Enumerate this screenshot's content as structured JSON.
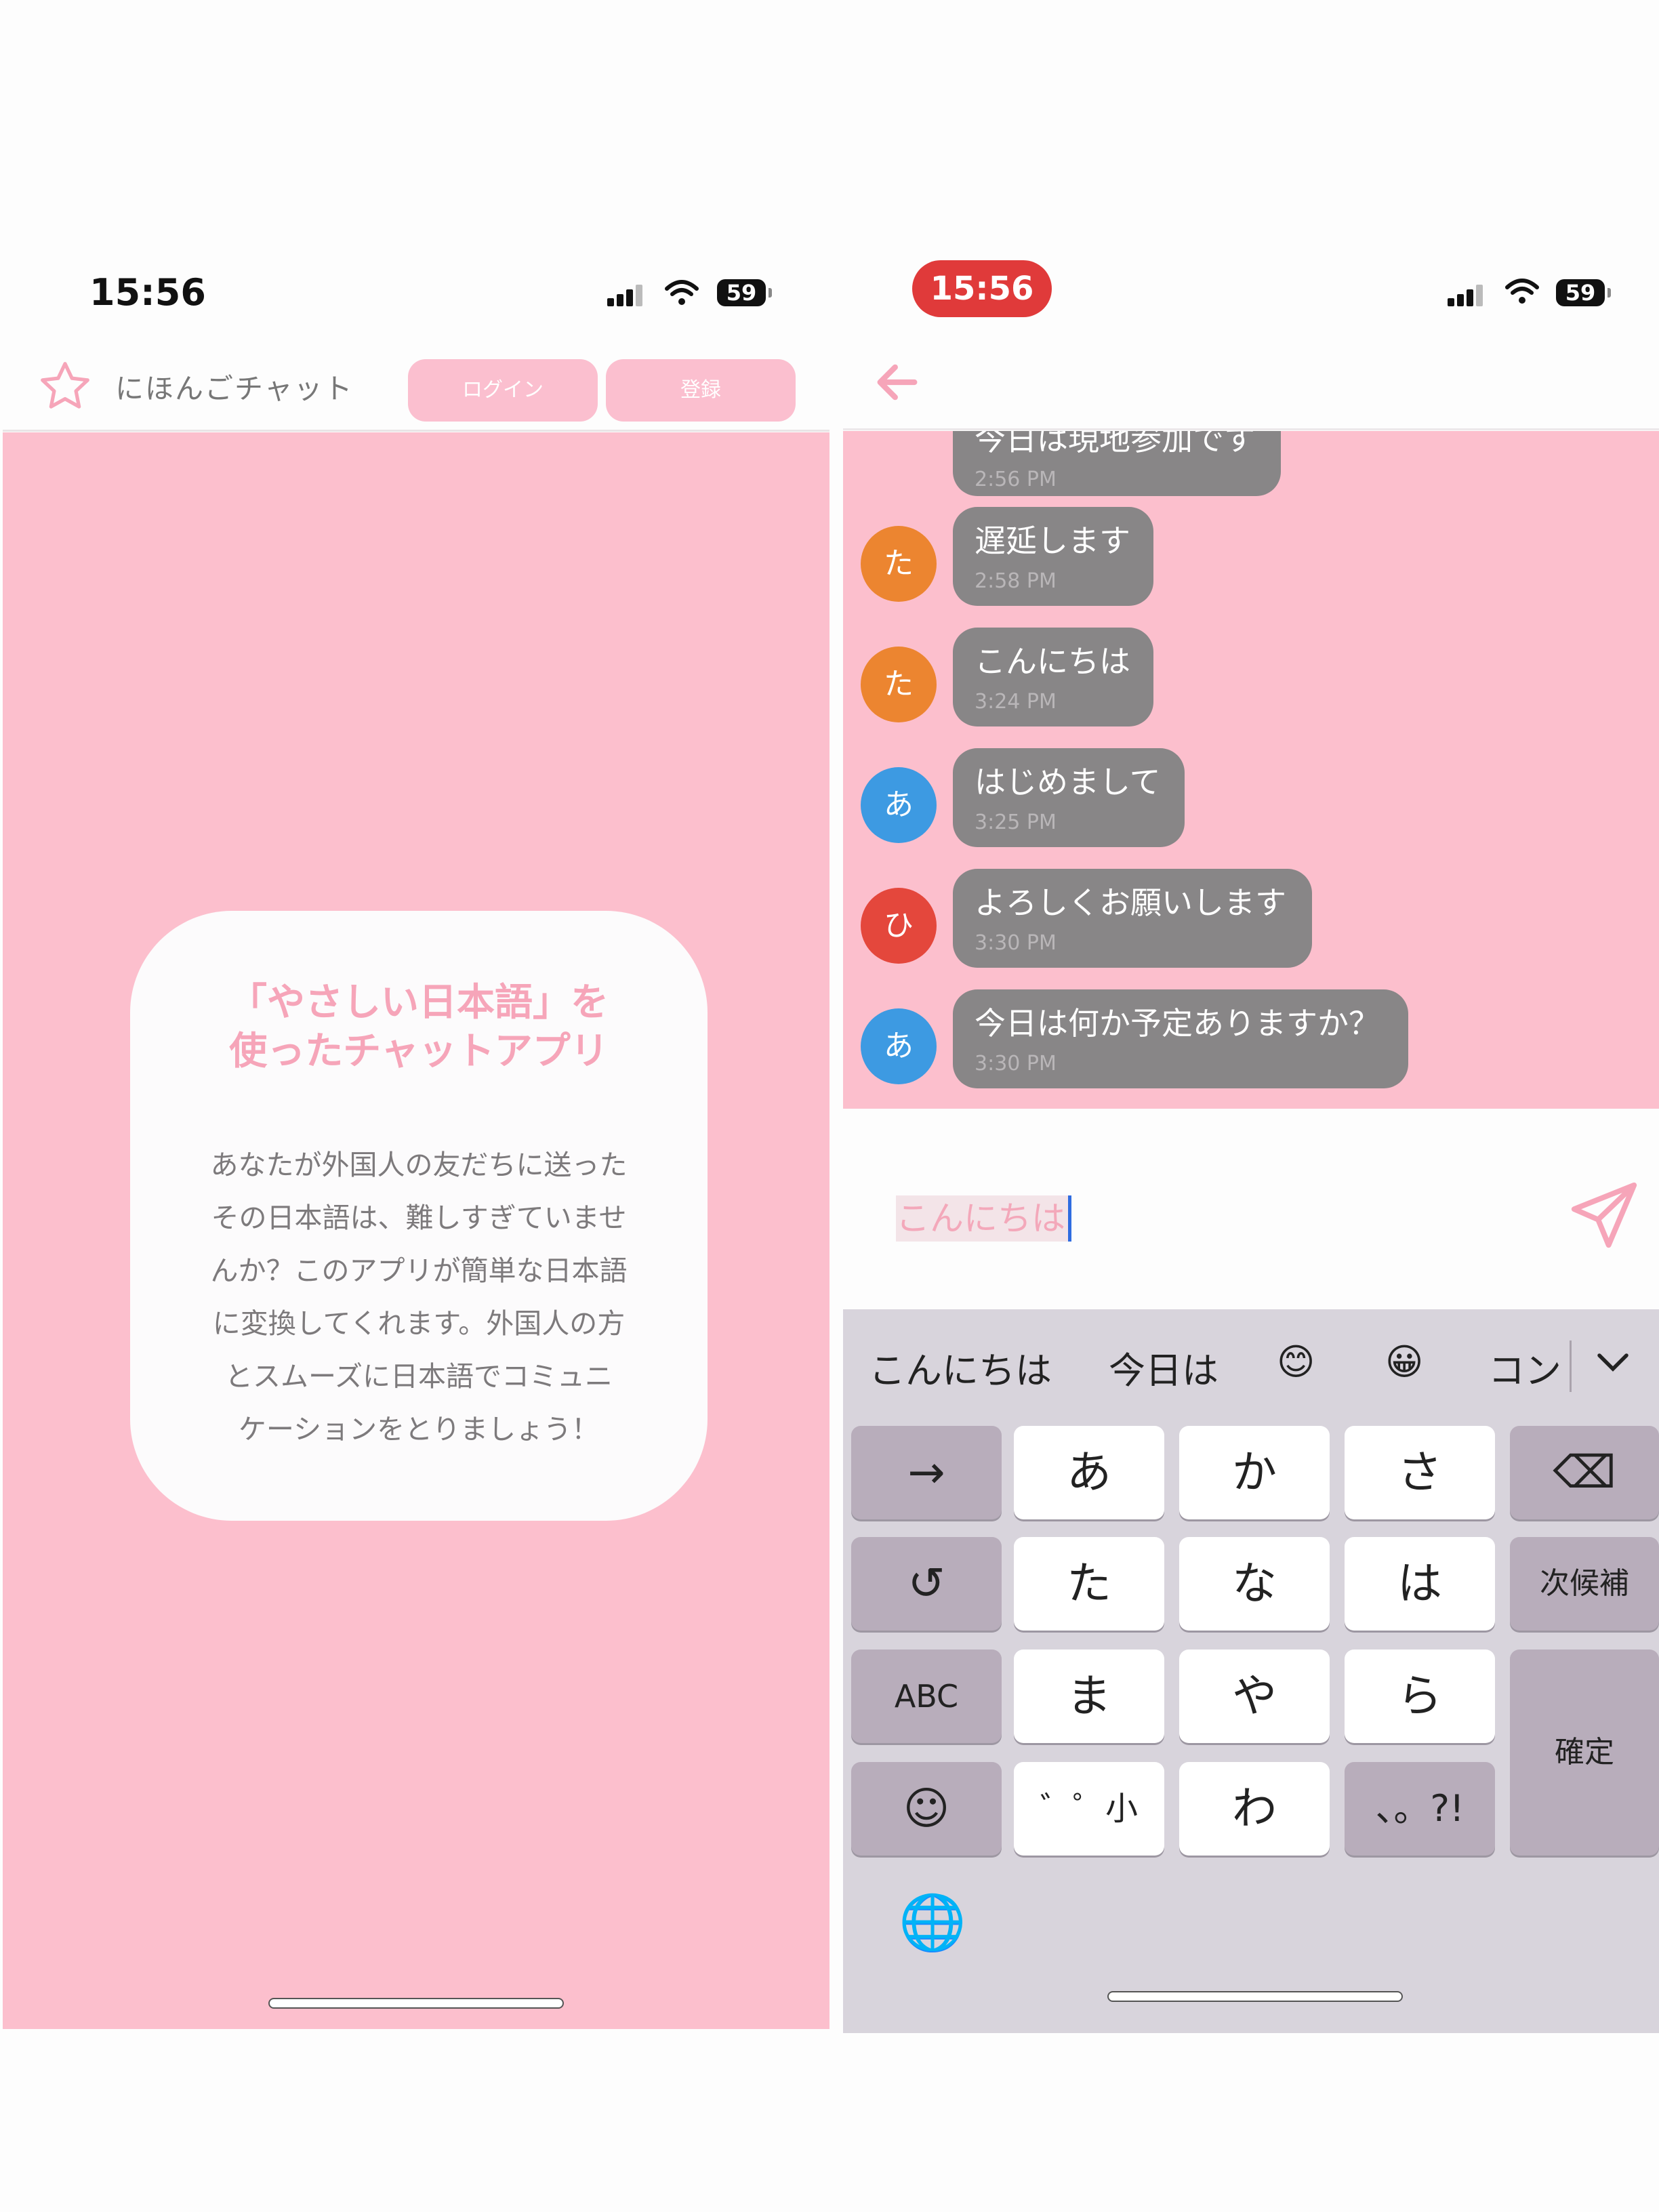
{
  "left": {
    "status": {
      "time": "15:56",
      "battery": "59"
    },
    "header": {
      "app_title": "にほんごチャット",
      "login_label": "ログイン",
      "register_label": "登録"
    },
    "card": {
      "title_line1": "「やさしい日本語」を",
      "title_line2": "使ったチャットアプリ",
      "body_lines": [
        "あなたが外国人の友だちに送った",
        "その日本語は、難しすぎていませ",
        "んか？このアプリが簡単な日本語",
        "に変換してくれます。外国人の方",
        "とスムーズに日本語でコミュニ",
        "ケーションをとりましょう！"
      ]
    },
    "colors": {
      "pink_bg": "#fcbfcd",
      "accent": "#f6a5b9"
    }
  },
  "right": {
    "status": {
      "time": "15:56",
      "battery": "59"
    },
    "messages": [
      {
        "avatar": "",
        "text": "今日は現地参加です",
        "time": "2:56 PM"
      },
      {
        "avatar": "た",
        "avatar_color": "#ec8530",
        "text": "遅延します",
        "time": "2:58 PM"
      },
      {
        "avatar": "た",
        "avatar_color": "#ec8530",
        "text": "こんにちは",
        "time": "3:24 PM"
      },
      {
        "avatar": "あ",
        "avatar_color": "#3d9ae2",
        "text": "はじめまして",
        "time": "3:25 PM"
      },
      {
        "avatar": "ひ",
        "avatar_color": "#e4473c",
        "text": "よろしくお願いします",
        "time": "3:30 PM"
      },
      {
        "avatar": "あ",
        "avatar_color": "#3d9ae2",
        "text": "今日は何か予定ありますか？",
        "time": "3:30 PM"
      }
    ],
    "input": {
      "value": "こんにちは"
    },
    "keyboard": {
      "suggestions": [
        "こんにちは",
        "今日は",
        "😊",
        "😀",
        "コン"
      ],
      "rows": [
        [
          "→",
          "あ",
          "か",
          "さ",
          "⌫"
        ],
        [
          "↺",
          "た",
          "な",
          "は",
          "次候補"
        ],
        [
          "ABC",
          "ま",
          "や",
          "ら",
          "確定"
        ],
        [
          "☺",
          "゛゜小",
          "わ",
          "、。?!"
        ]
      ],
      "globe": "🌐"
    }
  }
}
